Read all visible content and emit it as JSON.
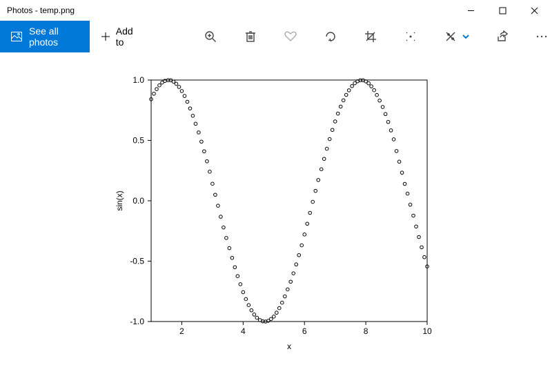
{
  "titlebar": {
    "title": "Photos - temp.png"
  },
  "toolbar": {
    "see_all_label": "See all photos",
    "add_to_label": "Add to"
  },
  "chart_data": {
    "type": "scatter",
    "title": "",
    "xlabel": "x",
    "ylabel": "sin(x)",
    "xlim": [
      1,
      10
    ],
    "ylim": [
      -1.0,
      1.0
    ],
    "x_ticks": [
      2,
      4,
      6,
      8,
      10
    ],
    "y_ticks": [
      -1.0,
      -0.5,
      0.0,
      0.5,
      1.0
    ],
    "x": [
      1.0,
      1.09,
      1.18,
      1.27,
      1.36,
      1.45,
      1.55,
      1.64,
      1.73,
      1.82,
      1.91,
      2.0,
      2.09,
      2.18,
      2.27,
      2.36,
      2.45,
      2.55,
      2.64,
      2.73,
      2.82,
      2.91,
      3.0,
      3.09,
      3.18,
      3.27,
      3.36,
      3.45,
      3.55,
      3.64,
      3.73,
      3.82,
      3.91,
      4.0,
      4.09,
      4.18,
      4.27,
      4.36,
      4.45,
      4.55,
      4.64,
      4.73,
      4.82,
      4.91,
      5.0,
      5.09,
      5.18,
      5.27,
      5.36,
      5.45,
      5.55,
      5.64,
      5.73,
      5.82,
      5.91,
      6.0,
      6.09,
      6.18,
      6.27,
      6.36,
      6.45,
      6.55,
      6.64,
      6.73,
      6.82,
      6.91,
      7.0,
      7.09,
      7.18,
      7.27,
      7.36,
      7.45,
      7.55,
      7.64,
      7.73,
      7.82,
      7.91,
      8.0,
      8.09,
      8.18,
      8.27,
      8.36,
      8.45,
      8.55,
      8.64,
      8.73,
      8.82,
      8.91,
      9.0,
      9.09,
      9.18,
      9.27,
      9.36,
      9.45,
      9.55,
      9.64,
      9.73,
      9.82,
      9.91,
      10.0
    ],
    "y": [
      0.841,
      0.887,
      0.925,
      0.956,
      0.979,
      0.993,
      0.999,
      0.998,
      0.987,
      0.969,
      0.943,
      0.909,
      0.868,
      0.82,
      0.765,
      0.704,
      0.638,
      0.566,
      0.49,
      0.41,
      0.327,
      0.241,
      0.141,
      0.05,
      -0.041,
      -0.132,
      -0.221,
      -0.308,
      -0.392,
      -0.473,
      -0.55,
      -0.624,
      -0.691,
      -0.757,
      -0.814,
      -0.864,
      -0.907,
      -0.942,
      -0.969,
      -0.988,
      -0.998,
      -1.0,
      -0.994,
      -0.979,
      -0.959,
      -0.927,
      -0.889,
      -0.844,
      -0.792,
      -0.734,
      -0.67,
      -0.601,
      -0.527,
      -0.45,
      -0.369,
      -0.279,
      -0.19,
      -0.1,
      -0.009,
      0.082,
      0.172,
      0.261,
      0.347,
      0.431,
      0.511,
      0.587,
      0.657,
      0.722,
      0.78,
      0.832,
      0.877,
      0.915,
      0.95,
      0.974,
      0.99,
      0.998,
      0.998,
      0.989,
      0.973,
      0.948,
      0.916,
      0.876,
      0.83,
      0.777,
      0.718,
      0.653,
      0.583,
      0.509,
      0.412,
      0.324,
      0.233,
      0.14,
      0.059,
      -0.032,
      -0.123,
      -0.213,
      -0.3,
      -0.385,
      -0.467,
      -0.544
    ]
  }
}
